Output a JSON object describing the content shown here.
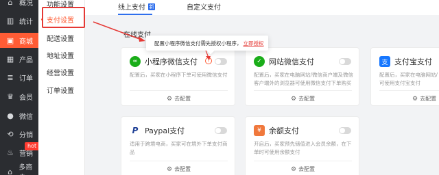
{
  "sidebar": {
    "items": [
      {
        "label": "概况",
        "icon": "home-icon",
        "active": false
      },
      {
        "label": "统计",
        "icon": "chart-icon",
        "active": false
      },
      {
        "label": "商城",
        "icon": "shop-icon",
        "active": true
      },
      {
        "label": "产品",
        "icon": "grid-icon",
        "active": false
      },
      {
        "label": "订单",
        "icon": "list-icon",
        "active": false
      },
      {
        "label": "会员",
        "icon": "crown-icon",
        "active": false
      },
      {
        "label": "微信",
        "icon": "wechat-icon",
        "active": false
      },
      {
        "label": "分销",
        "icon": "share-icon",
        "active": false
      },
      {
        "label": "营销",
        "icon": "marketing-icon",
        "active": false
      },
      {
        "label": "多商户",
        "icon": "store-icon",
        "active": false
      }
    ],
    "hot_badge": "hot"
  },
  "subnav": {
    "items": [
      {
        "label": "功能设置"
      },
      {
        "label": "支付设置"
      },
      {
        "label": "配送设置"
      },
      {
        "label": "地址设置"
      },
      {
        "label": "经营设置"
      },
      {
        "label": "订单设置"
      }
    ]
  },
  "tabs": {
    "online": "线上支付",
    "online_badge": "新",
    "custom": "自定义支付"
  },
  "section_title": "在线支付",
  "tooltip": {
    "text": "配置小程序微信支付需先授权小程序，",
    "link": "立即授权"
  },
  "cards": [
    {
      "title": "小程序微信支付",
      "desc": "配置后，买家在小程序下单可使用微信支付",
      "action": "去配置",
      "color": "#1aad19",
      "icon_glyph": "∞"
    },
    {
      "title": "网站微信支付",
      "desc1": "配置后，买家在电脑网站/微信商户端及微信",
      "desc2": "客户端外的浏览器可使用微信支付下单购买",
      "action": "去配置",
      "color": "#1aad19",
      "icon_glyph": "✓"
    },
    {
      "title": "支付宝支付",
      "desc1": "配置后，买家在电脑网站/",
      "desc2": "可使用支付宝支付",
      "action": "去配置",
      "color": "#1677ff",
      "icon_glyph": "支"
    },
    {
      "title": "Paypal支付",
      "desc1": "适用于跨境电商，买家可在境外下单支付商",
      "desc2": "品",
      "action": "去配置",
      "color": "#1e3f96",
      "icon_glyph": "P"
    },
    {
      "title": "余额支付",
      "desc1": "开启后，买家预先储值进入会员余额，在下",
      "desc2": "单时可使用余额支付",
      "action": "去配置",
      "color": "#f0783c",
      "icon_glyph": "¥"
    }
  ],
  "colors": {
    "accent": "#ff5c35",
    "tab_active": "#2f6fed",
    "annotation_red": "#e53935"
  }
}
